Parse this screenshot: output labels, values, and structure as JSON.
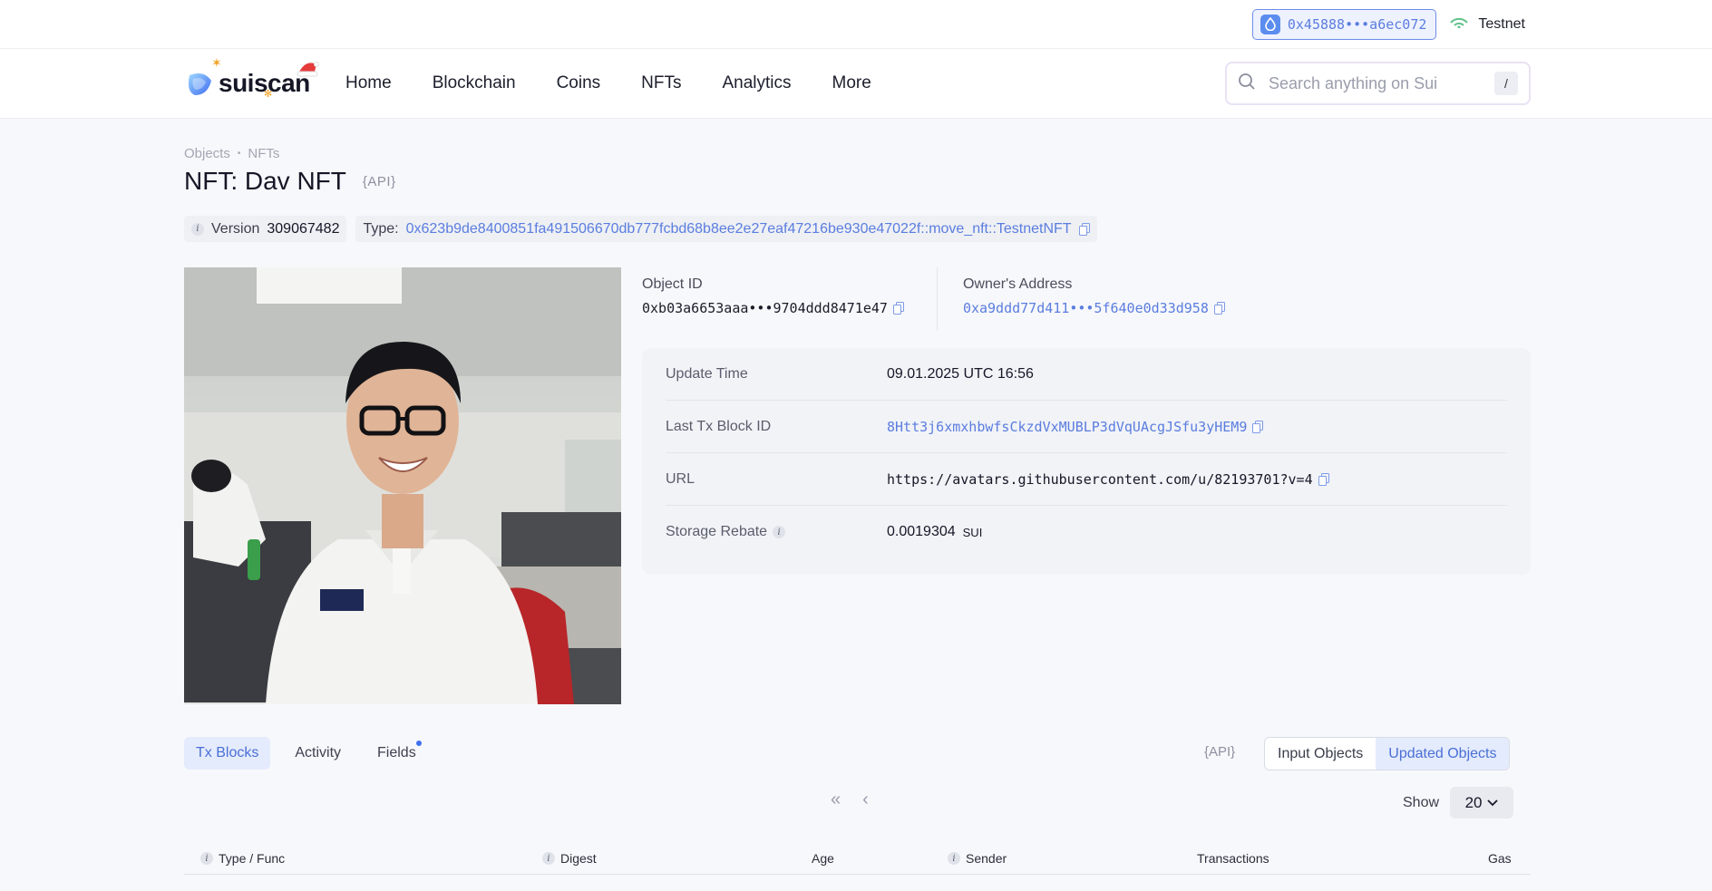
{
  "topbar": {
    "wallet_address": "0x45888•••a6ec072",
    "network": "Testnet"
  },
  "header": {
    "logo_text": "suiscan",
    "nav": [
      "Home",
      "Blockchain",
      "Coins",
      "NFTs",
      "Analytics",
      "More"
    ],
    "search_placeholder": "Search anything on Sui",
    "search_shortcut": "/"
  },
  "breadcrumb": [
    "Objects",
    "NFTs"
  ],
  "page": {
    "title": "NFT: Dav NFT",
    "api_label": "{API}",
    "version_label": "Version",
    "version_value": "309067482",
    "type_label": "Type:",
    "type_value": "0x623b9de8400851fa491506670db777fcbd68b8ee2e27eaf47216be930e47022f::move_nft::TestnetNFT"
  },
  "ids": {
    "object_id_label": "Object ID",
    "object_id_value": "0xb03a6653aaa•••9704ddd8471e47",
    "owner_label": "Owner's Address",
    "owner_value": "0xa9ddd77d411•••5f640e0d33d958"
  },
  "details": [
    {
      "label": "Update Time",
      "value": "09.01.2025 UTC 16:56",
      "kind": "text"
    },
    {
      "label": "Last Tx Block ID",
      "value": "8Htt3j6xmxhbwfsCkzdVxMUBLP3dVqUAcgJSfu3yHEM9",
      "kind": "link"
    },
    {
      "label": "URL",
      "value": "https://avatars.githubusercontent.com/u/82193701?v=4",
      "kind": "mono"
    },
    {
      "label": "Storage Rebate",
      "value": "0.0019304",
      "unit": "SUI",
      "kind": "amount"
    }
  ],
  "tabs": [
    "Tx Blocks",
    "Activity",
    "Fields"
  ],
  "api_label_2": "{API}",
  "object_toggle": [
    "Input Objects",
    "Updated Objects"
  ],
  "pager": {
    "first": "«",
    "prev": "‹"
  },
  "show": {
    "label": "Show",
    "value": "20"
  },
  "table_columns": [
    "Type / Func",
    "Digest",
    "Age",
    "Sender",
    "Transactions",
    "Gas"
  ],
  "colors": {
    "accent": "#5b7ddf",
    "accent_bg": "#e4ebfc",
    "page_bg": "#f7f8fb"
  }
}
